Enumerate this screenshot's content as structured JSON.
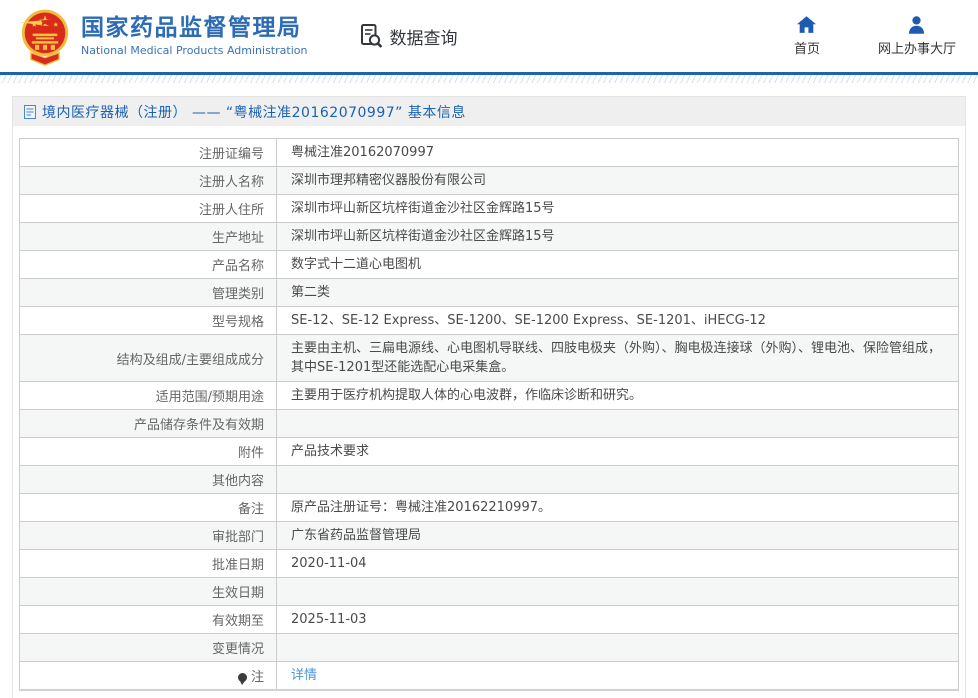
{
  "header": {
    "org_name_cn": "国家药品监督管理局",
    "org_name_en": "National Medical Products Administration",
    "data_query_label": "数据查询",
    "nav_home_label": "首页",
    "nav_hall_label": "网上办事大厅"
  },
  "icons": {
    "emblem": "china-national-emblem",
    "data_query": "document-with-magnifier",
    "home": "house-glyph",
    "hall": "person-glyph",
    "title_doc": "blue-document-sheet",
    "note": "black-speech-balloon"
  },
  "colors": {
    "brand_blue": "#2d6cb5",
    "header_line_blue": "#1e63b0",
    "title_blue": "#1a62b2",
    "link_blue": "#4b96db",
    "row_alt_bg": "#f5f6f6",
    "table_border": "#cccccc",
    "title_strip_bg": "#efefef",
    "emblem_red": "#d92b1c",
    "emblem_gold": "#eebd3c"
  },
  "page": {
    "title": "境内医疗器械（注册） —— “粤械注准20162070997” 基本信息"
  },
  "table": {
    "rows": [
      {
        "label": "注册证编号",
        "value": "粤械注准20162070997"
      },
      {
        "label": "注册人名称",
        "value": "深圳市理邦精密仪器股份有限公司"
      },
      {
        "label": "注册人住所",
        "value": "深圳市坪山新区坑梓街道金沙社区金辉路15号"
      },
      {
        "label": "生产地址",
        "value": "深圳市坪山新区坑梓街道金沙社区金辉路15号"
      },
      {
        "label": "产品名称",
        "value": "数字式十二道心电图机"
      },
      {
        "label": "管理类别",
        "value": "第二类"
      },
      {
        "label": "型号规格",
        "value": "SE-12、SE-12 Express、SE-1200、SE-1200 Express、SE-1201、iHECG-12"
      },
      {
        "label": "结构及组成/主要组成成分",
        "value": "主要由主机、三扁电源线、心电图机导联线、四肢电极夹（外购）、胸电极连接球（外购）、锂电池、保险管组成，其中SE-1201型还能选配心电采集盒。"
      },
      {
        "label": "适用范围/预期用途",
        "value": "主要用于医疗机构提取人体的心电波群，作临床诊断和研究。"
      },
      {
        "label": "产品储存条件及有效期",
        "value": ""
      },
      {
        "label": "附件",
        "value": "产品技术要求"
      },
      {
        "label": "其他内容",
        "value": ""
      },
      {
        "label": "备注",
        "value": "原产品注册证号：粤械注准20162210997。"
      },
      {
        "label": "审批部门",
        "value": "广东省药品监督管理局"
      },
      {
        "label": "批准日期",
        "value": "2020-11-04"
      },
      {
        "label": "生效日期",
        "value": ""
      },
      {
        "label": "有效期至",
        "value": "2025-11-03"
      },
      {
        "label": "变更情况",
        "value": ""
      },
      {
        "label": "注",
        "value": "详情",
        "link": true,
        "note_icon": true
      }
    ]
  }
}
